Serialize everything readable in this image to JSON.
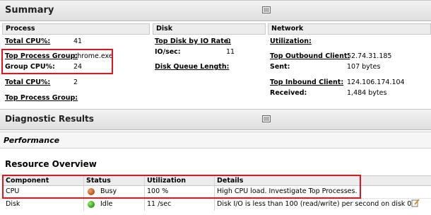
{
  "summary": {
    "title": "Summary",
    "process": {
      "header": "Process",
      "total_cpu_label": "Total CPU%:",
      "total_cpu_value": "41",
      "top_group_label": "Top Process Group:",
      "top_group_value": "chrome.exe",
      "group_cpu_label": "Group CPU%:",
      "group_cpu_value": "24",
      "total_cpu2_label": "Total CPU%:",
      "total_cpu2_value": "2",
      "top_group2_label": "Top Process Group:"
    },
    "disk": {
      "header": "Disk",
      "top_disk_label": "Top Disk by IO Rate:",
      "top_disk_value": "0",
      "io_label": "IO/sec:",
      "io_value": "11",
      "queue_label": "Disk Queue Length:"
    },
    "network": {
      "header": "Network",
      "util_label": "Utilization:",
      "out_label": "Top Outbound Client:",
      "out_value": "52.74.31.185",
      "sent_label": "Sent:",
      "sent_value": "107 bytes",
      "in_label": "Top Inbound Client:",
      "in_value": "124.106.174.104",
      "recv_label": "Received:",
      "recv_value": "1,484 bytes"
    }
  },
  "diagnostic": {
    "title": "Diagnostic Results"
  },
  "performance": {
    "title": "Performance"
  },
  "resource": {
    "title": "Resource Overview",
    "columns": [
      "Component",
      "Status",
      "Utilization",
      "Details"
    ],
    "rows": [
      {
        "component": "CPU",
        "status": "Busy",
        "status_color": "#c8641e",
        "utilization": "100 %",
        "details": "High CPU load. Investigate Top Processes."
      },
      {
        "component": "Disk",
        "status": "Idle",
        "status_color": "#3db31e",
        "utilization": "11 /sec",
        "details": "Disk I/O is less than 100 (read/write) per second on disk 0."
      }
    ]
  },
  "colors": {
    "highlight": "#e0141e",
    "header_bg": "#dedede"
  }
}
